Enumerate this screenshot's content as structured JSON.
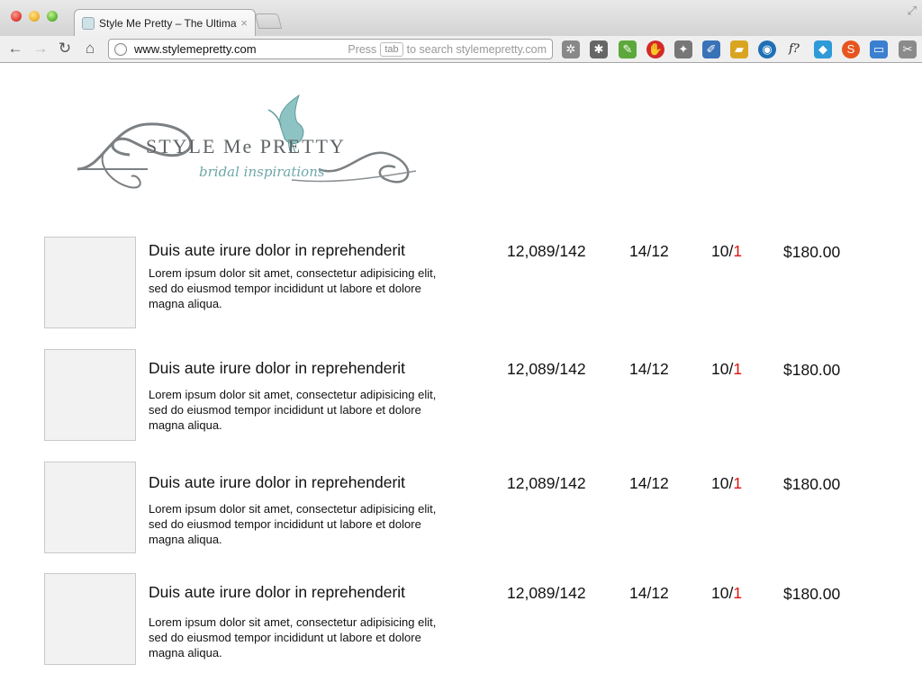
{
  "browser": {
    "tab_title": "Style Me Pretty – The Ultimat",
    "close_label": "×",
    "address": "www.stylemepretty.com",
    "hint_press": "Press",
    "hint_key": "tab",
    "hint_rest": "to search stylemepretty.com"
  },
  "logo": {
    "title": "STYLE Me PRETTY",
    "tagline": "bridal inspirations"
  },
  "items": [
    {
      "title": "Duis aute irure dolor in reprehenderit",
      "description": "Lorem ipsum dolor sit amet, consectetur adipisicing elit, sed do eiusmod tempor incididunt ut labore et dolore magna aliqua.",
      "stat1": "12,089/142",
      "stat2": "14/12",
      "stat3_prefix": "10/",
      "stat3_highlight": "1",
      "price": "$180.00"
    },
    {
      "title": "Duis aute irure dolor in reprehenderit",
      "description": "Lorem ipsum dolor sit amet, consectetur adipisicing elit, sed do eiusmod tempor incididunt ut labore et dolore magna aliqua.",
      "stat1": "12,089/142",
      "stat2": "14/12",
      "stat3_prefix": "10/",
      "stat3_highlight": "1",
      "price": "$180.00"
    },
    {
      "title": "Duis aute irure dolor in reprehenderit",
      "description": "Lorem ipsum dolor sit amet, consectetur adipisicing elit, sed do eiusmod tempor incididunt ut labore et dolore magna aliqua.",
      "stat1": "12,089/142",
      "stat2": "14/12",
      "stat3_prefix": "10/",
      "stat3_highlight": "1",
      "price": "$180.00"
    },
    {
      "title": "Duis aute irure dolor in reprehenderit",
      "description": "Lorem ipsum dolor sit amet, consectetur adipisicing elit, sed do eiusmod tempor incididunt ut labore et dolore magna aliqua.",
      "stat1": "12,089/142",
      "stat2": "14/12",
      "stat3_prefix": "10/",
      "stat3_highlight": "1",
      "price": "$180.00"
    }
  ],
  "colors": {
    "highlight": "#e0140f",
    "logo_gray": "#5f6366",
    "logo_teal": "#6fa7a8"
  },
  "icons": [
    "back-icon",
    "forward-icon",
    "reload-icon",
    "home-icon",
    "globe-icon",
    "gear-icon",
    "bug-icon",
    "evernote-icon",
    "stop-icon",
    "twitter-icon",
    "eyedropper-icon",
    "truck-icon",
    "eye-icon",
    "function-icon",
    "bird-icon",
    "stumbleupon-icon",
    "window-icon",
    "wrench-icon"
  ]
}
